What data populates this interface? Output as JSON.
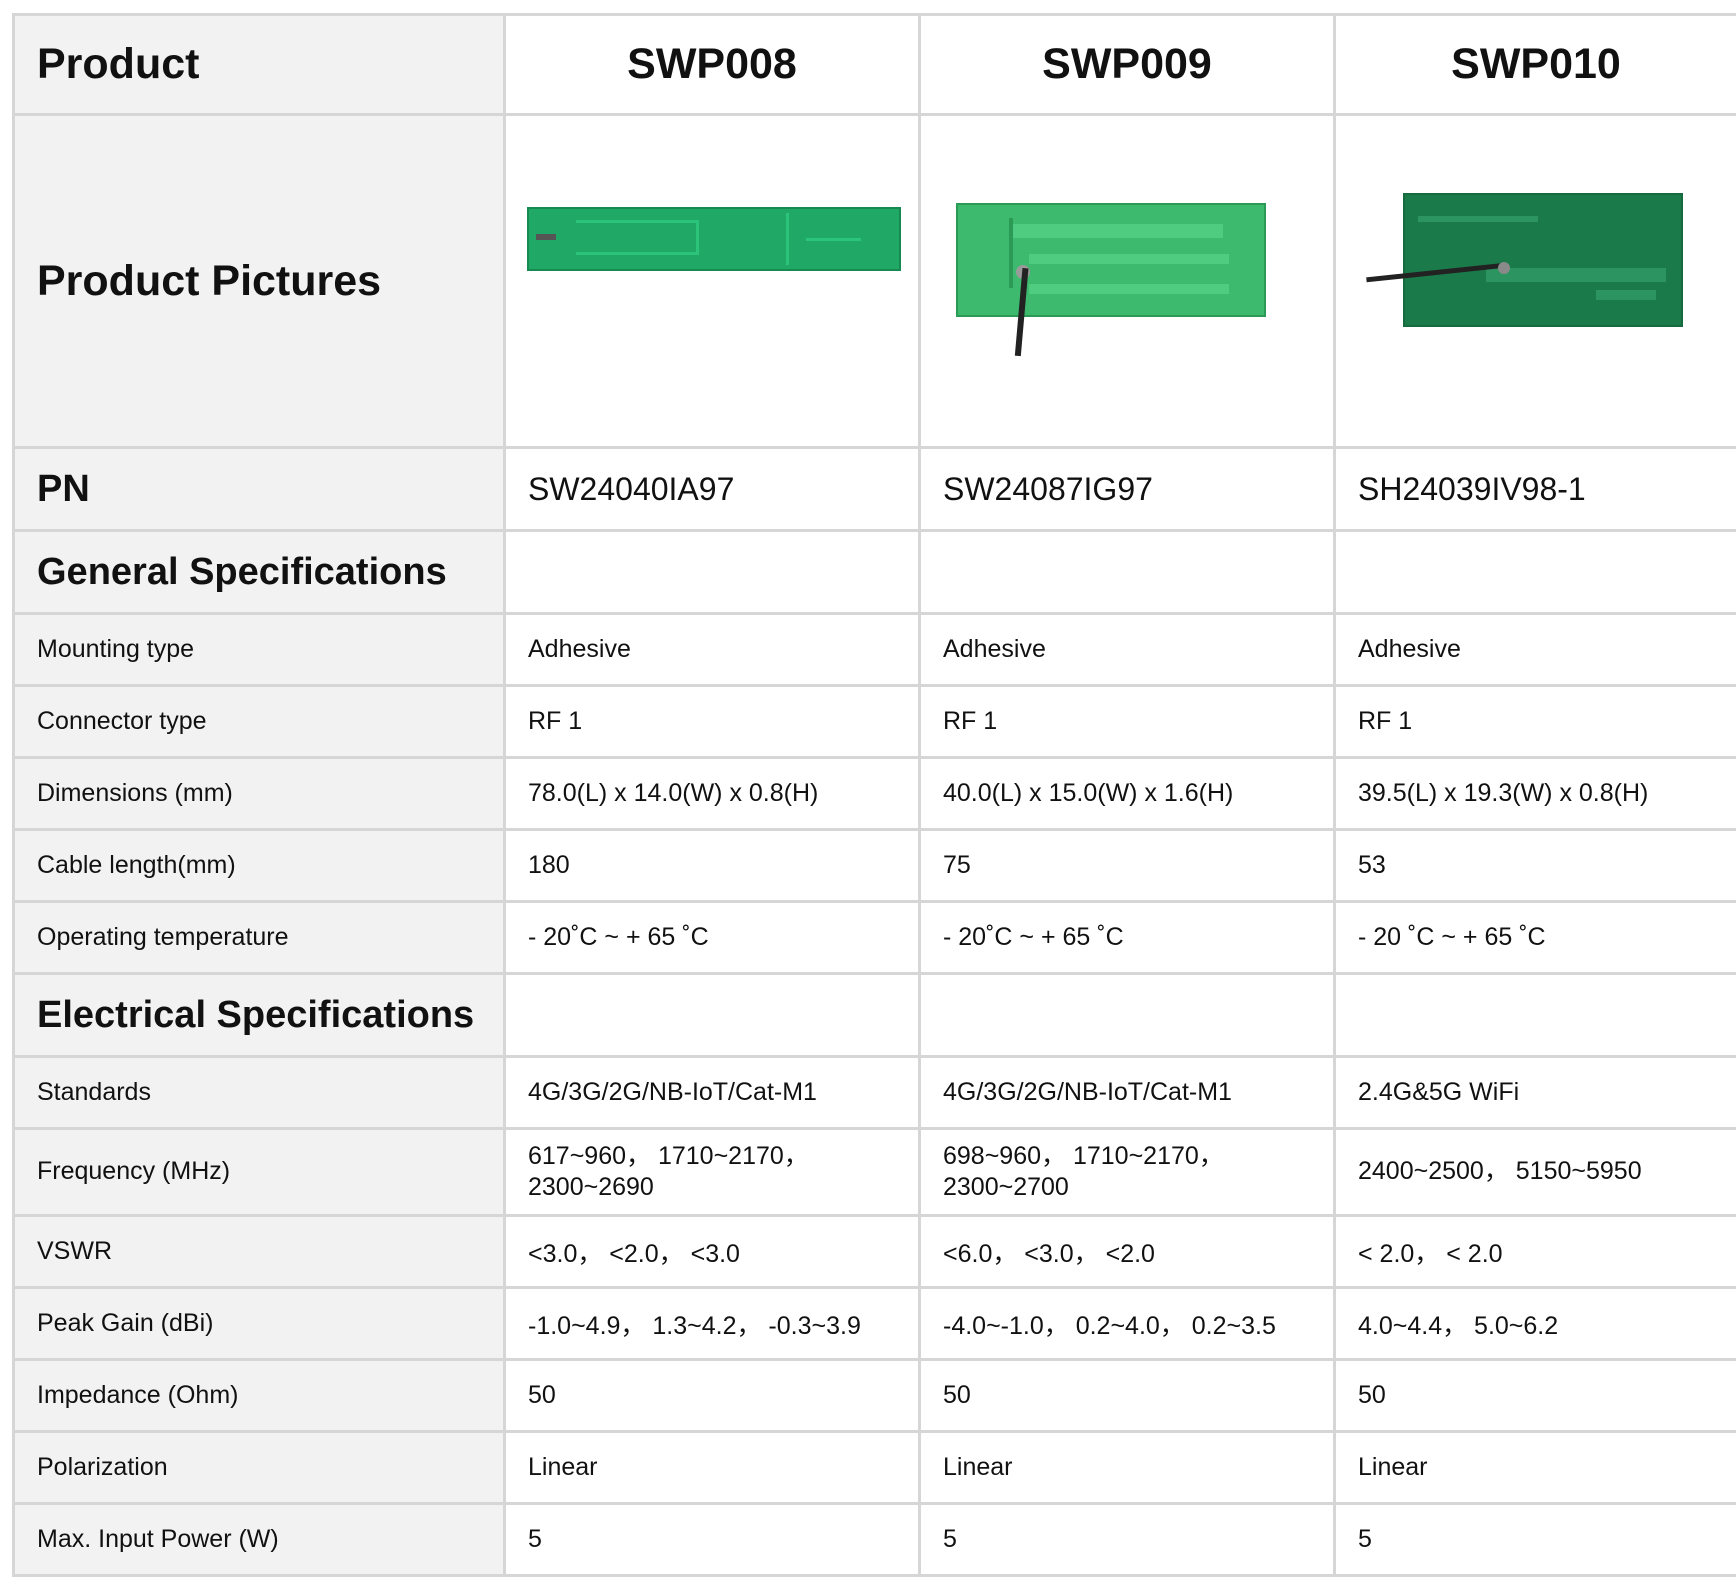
{
  "table": {
    "header": {
      "label": "Product",
      "products": [
        "SWP008",
        "SWP009",
        "SWP010"
      ]
    },
    "pictures": {
      "label": "Product Pictures"
    },
    "pn": {
      "label": "PN",
      "values": [
        "SW24040IA97",
        "SW24087IG97",
        "SH24039IV98-1"
      ]
    },
    "general_section": "General Specifications",
    "general_rows": [
      {
        "label": "Mounting type",
        "values": [
          "Adhesive",
          "Adhesive",
          "Adhesive"
        ]
      },
      {
        "label": "Connector type",
        "values": [
          "RF 1",
          "RF 1",
          "RF 1"
        ]
      },
      {
        "label": "Dimensions (mm)",
        "values": [
          "78.0(L) x 14.0(W) x 0.8(H)",
          "40.0(L) x 15.0(W) x 1.6(H)",
          "39.5(L) x 19.3(W) x 0.8(H)"
        ]
      },
      {
        "label": "Cable length(mm)",
        "values": [
          "180",
          "75",
          "53"
        ]
      },
      {
        "label": "Operating temperature",
        "values": [
          "- 20˚C ~ + 65 ˚C",
          "- 20˚C ~ + 65 ˚C",
          "- 20 ˚C ~ + 65 ˚C"
        ]
      }
    ],
    "electrical_section": "Electrical Specifications",
    "electrical_rows": [
      {
        "label": "Standards",
        "values": [
          "4G/3G/2G/NB-IoT/Cat-M1",
          "4G/3G/2G/NB-IoT/Cat-M1",
          "2.4G&5G WiFi"
        ]
      },
      {
        "label": "Frequency (MHz)",
        "values": [
          "617~960， 1710~2170， 2300~2690",
          "698~960，  1710~2170， 2300~2700",
          "2400~2500，  5150~5950"
        ]
      },
      {
        "label": "VSWR",
        "values": [
          "<3.0， <2.0， <3.0",
          "<6.0，  <3.0，  <2.0",
          "< 2.0，  < 2.0"
        ]
      },
      {
        "label": "Peak Gain (dBi)",
        "values": [
          "-1.0~4.9， 1.3~4.2， -0.3~3.9",
          "-4.0~-1.0，  0.2~4.0，  0.2~3.5",
          "4.0~4.4， 5.0~6.2"
        ]
      },
      {
        "label": "Impedance (Ohm)",
        "values": [
          "50",
          "50",
          "50"
        ]
      },
      {
        "label": "Polarization",
        "values": [
          "Linear",
          "Linear",
          "Linear"
        ]
      },
      {
        "label": "Max. Input Power (W)",
        "values": [
          "5",
          "5",
          "5"
        ]
      }
    ]
  }
}
